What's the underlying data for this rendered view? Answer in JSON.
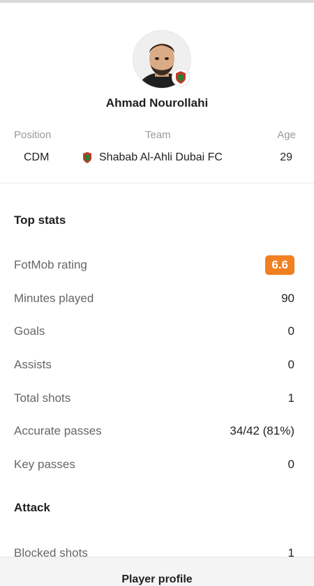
{
  "player": {
    "name": "Ahmad Nourollahi",
    "position_label": "Position",
    "position_value": "CDM",
    "team_label": "Team",
    "team_value": "Shabab Al-Ahli Dubai FC",
    "age_label": "Age",
    "age_value": "29"
  },
  "top_stats": {
    "title": "Top stats",
    "rows": [
      {
        "label": "FotMob rating",
        "value": "6.6"
      },
      {
        "label": "Minutes played",
        "value": "90"
      },
      {
        "label": "Goals",
        "value": "0"
      },
      {
        "label": "Assists",
        "value": "0"
      },
      {
        "label": "Total shots",
        "value": "1"
      },
      {
        "label": "Accurate passes",
        "value": "34/42 (81%)"
      },
      {
        "label": "Key passes",
        "value": "0"
      }
    ]
  },
  "attack": {
    "title": "Attack",
    "rows": [
      {
        "label": "Blocked shots",
        "value": "1"
      }
    ]
  },
  "footer": {
    "button_label": "Player profile"
  },
  "colors": {
    "rating_badge": "#f08022"
  },
  "icons": {
    "avatar": "player-photo",
    "team": "club-crest-icon"
  }
}
